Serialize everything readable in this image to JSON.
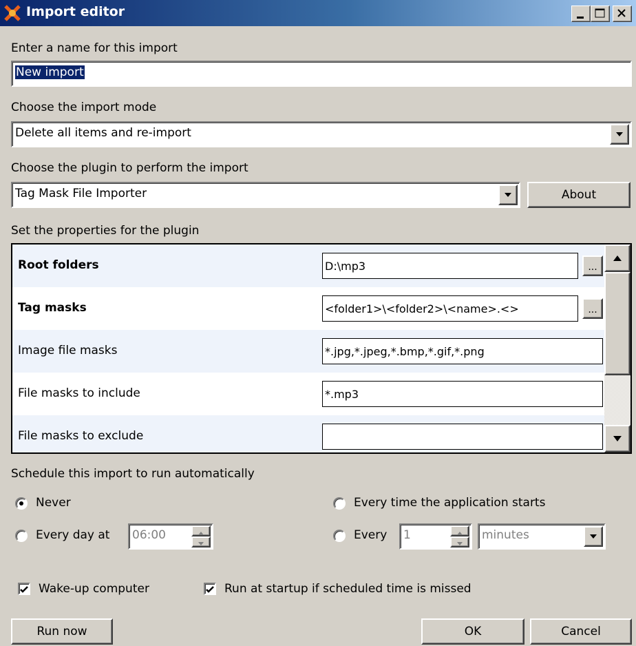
{
  "window": {
    "title": "Import editor"
  },
  "name_section": {
    "label": "Enter a name for this import",
    "value": "New import"
  },
  "mode_section": {
    "label": "Choose the import mode",
    "selected": "Delete all items and re-import"
  },
  "plugin_section": {
    "label": "Choose the plugin to perform the import",
    "selected": "Tag Mask File Importer",
    "about_label": "About"
  },
  "properties": {
    "label": "Set the properties for the plugin",
    "rows": [
      {
        "name": "Root folders",
        "value": "D:\\mp3",
        "bold": true,
        "has_browse": true
      },
      {
        "name": "Tag masks",
        "value": "<folder1>\\<folder2>\\<name>.<>",
        "bold": true,
        "has_browse": true
      },
      {
        "name": "Image file masks",
        "value": "*.jpg,*.jpeg,*.bmp,*.gif,*.png",
        "bold": false,
        "has_browse": false
      },
      {
        "name": "File masks to include",
        "value": "*.mp3",
        "bold": false,
        "has_browse": false
      },
      {
        "name": "File masks to exclude",
        "value": "",
        "bold": false,
        "has_browse": false
      }
    ],
    "browse_label": "..."
  },
  "schedule": {
    "label": "Schedule this import to run automatically",
    "never_label": "Never",
    "every_time_label": "Every time the application starts",
    "every_day_label": "Every day at",
    "every_day_time": "06:00",
    "every_label": "Every",
    "every_count": "1",
    "every_unit": "minutes",
    "selected": "never"
  },
  "options": {
    "wake_label": "Wake-up computer",
    "wake_checked": true,
    "startup_label": "Run at startup if scheduled time is missed",
    "startup_checked": true
  },
  "buttons": {
    "run_now": "Run now",
    "ok": "OK",
    "cancel": "Cancel"
  }
}
